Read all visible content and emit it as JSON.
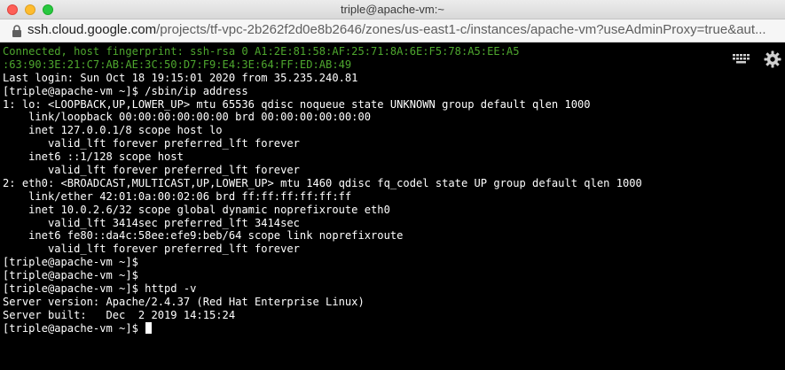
{
  "window": {
    "title": "triple@apache-vm:~"
  },
  "address_bar": {
    "host": "ssh.cloud.google.com",
    "path": "/projects/tf-vpc-2b262f2d0e8b2646/zones/us-east1-c/instances/apache-vm?useAdminProxy=true&aut..."
  },
  "toolbar": {
    "keyboard_icon": "keyboard-icon",
    "settings_icon": "gear-icon"
  },
  "colors": {
    "terminal_background": "#000000",
    "terminal_text": "#ffffff",
    "notice_text": "#4ea72e"
  },
  "terminal": {
    "lines": [
      "Connected, host fingerprint: ssh-rsa 0 A1:2E:81:58:AF:25:71:8A:6E:F5:78:A5:EE:A5",
      ":63:90:3E:21:C7:AB:AE:3C:50:D7:F9:E4:3E:64:FF:ED:AB:49",
      "Last login: Sun Oct 18 19:15:01 2020 from 35.235.240.81",
      "[triple@apache-vm ~]$ /sbin/ip address",
      "1: lo: <LOOPBACK,UP,LOWER_UP> mtu 65536 qdisc noqueue state UNKNOWN group default qlen 1000",
      "    link/loopback 00:00:00:00:00:00 brd 00:00:00:00:00:00",
      "    inet 127.0.0.1/8 scope host lo",
      "       valid_lft forever preferred_lft forever",
      "    inet6 ::1/128 scope host",
      "       valid_lft forever preferred_lft forever",
      "2: eth0: <BROADCAST,MULTICAST,UP,LOWER_UP> mtu 1460 qdisc fq_codel state UP group default qlen 1000",
      "    link/ether 42:01:0a:00:02:06 brd ff:ff:ff:ff:ff:ff",
      "    inet 10.0.2.6/32 scope global dynamic noprefixroute eth0",
      "       valid_lft 3414sec preferred_lft 3414sec",
      "    inet6 fe80::da4c:58ee:efe9:beb/64 scope link noprefixroute",
      "       valid_lft forever preferred_lft forever",
      "[triple@apache-vm ~]$",
      "[triple@apache-vm ~]$",
      "[triple@apache-vm ~]$ httpd -v",
      "Server version: Apache/2.4.37 (Red Hat Enterprise Linux)",
      "Server built:   Dec  2 2019 14:15:24",
      "[triple@apache-vm ~]$ "
    ]
  }
}
